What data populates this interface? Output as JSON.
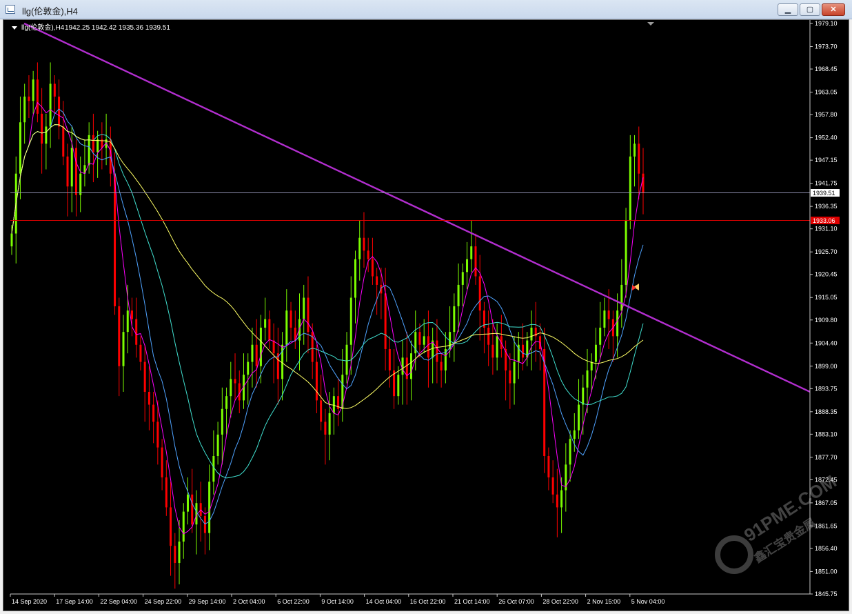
{
  "window": {
    "title": "llg(伦敦金),H4",
    "icon": "chart-window-icon",
    "min_label": "▁",
    "max_label": "▢",
    "close_label": "✕"
  },
  "chart_header": {
    "symbol": "llg(伦敦金),H4",
    "ohlc": "1942.25 1942.42 1935.36 1939.51"
  },
  "chart_data": {
    "type": "candlestick",
    "title": "llg(伦敦金),H4",
    "ylim": [
      1845.75,
      1979.1
    ],
    "price_ticks": [
      "1979.10",
      "1973.70",
      "1968.45",
      "1963.05",
      "1957.80",
      "1952.40",
      "1947.15",
      "1941.75",
      "1936.35",
      "1931.10",
      "1925.70",
      "1920.45",
      "1915.05",
      "1909.80",
      "1904.40",
      "1899.00",
      "1893.75",
      "1888.35",
      "1883.10",
      "1877.70",
      "1872.45",
      "1867.05",
      "1861.65",
      "1856.40",
      "1851.00",
      "1845.75"
    ],
    "time_ticks": [
      "14 Sep 2020",
      "17 Sep 14:00",
      "22 Sep 04:00",
      "24 Sep 22:00",
      "29 Sep 14:00",
      "2 Oct 04:00",
      "6 Oct 22:00",
      "9 Oct 14:00",
      "14 Oct 04:00",
      "16 Oct 22:00",
      "21 Oct 14:00",
      "26 Oct 07:00",
      "28 Oct 22:00",
      "2 Nov 15:00",
      "5 Nov 04:00"
    ],
    "current_price": "1939.51",
    "current_price_value": 1939.51,
    "red_level_label": "1933.06",
    "red_level_value": 1933.06,
    "up_color": "#7CFC00",
    "down_color": "#FF0000",
    "trendline": {
      "color": "#B22ECF",
      "from": [
        0,
        1979.1
      ],
      "to": [
        1,
        1893.0
      ]
    },
    "closes": [
      1930,
      1944,
      1956,
      1962,
      1961,
      1966,
      1958,
      1951,
      1955,
      1965,
      1962,
      1955,
      1948,
      1941,
      1950,
      1939,
      1944,
      1946,
      1953,
      1949,
      1952,
      1950,
      1952,
      1944,
      1913,
      1899,
      1907,
      1912,
      1910,
      1904,
      1900,
      1893,
      1890,
      1886,
      1880,
      1873,
      1866,
      1857,
      1853,
      1858,
      1865,
      1869,
      1862,
      1867,
      1864,
      1860,
      1872,
      1878,
      1883,
      1889,
      1892,
      1896,
      1895,
      1891,
      1897,
      1900,
      1904,
      1899,
      1908,
      1910,
      1905,
      1902,
      1896,
      1904,
      1912,
      1908,
      1905,
      1910,
      1915,
      1907,
      1900,
      1891,
      1886,
      1883,
      1888,
      1892,
      1889,
      1897,
      1904,
      1915,
      1924,
      1929,
      1926,
      1924,
      1920,
      1918,
      1916,
      1903,
      1898,
      1892,
      1897,
      1901,
      1896,
      1902,
      1907,
      1904,
      1906,
      1901,
      1905,
      1900,
      1898,
      1903,
      1907,
      1913,
      1918,
      1921,
      1924,
      1927,
      1920,
      1912,
      1908,
      1904,
      1901,
      1906,
      1903,
      1898,
      1895,
      1900,
      1904,
      1901,
      1905,
      1908,
      1906,
      1903,
      1878,
      1873,
      1869,
      1866,
      1870,
      1876,
      1882,
      1884,
      1890,
      1894,
      1898,
      1900,
      1904,
      1908,
      1912,
      1910,
      1906,
      1912,
      1918,
      1933,
      1948,
      1951,
      1944,
      1939.5
    ],
    "ma_series": [
      {
        "color": "#FF00FF",
        "period": 5
      },
      {
        "color": "#4FA3FF",
        "period": 10
      },
      {
        "color": "#40E0D0",
        "period": 20
      },
      {
        "color": "#FFFF66",
        "period": 50
      }
    ],
    "grid": false
  },
  "watermark": {
    "site": "91PME.COM",
    "tagline": "鑫汇宝贵金属"
  }
}
